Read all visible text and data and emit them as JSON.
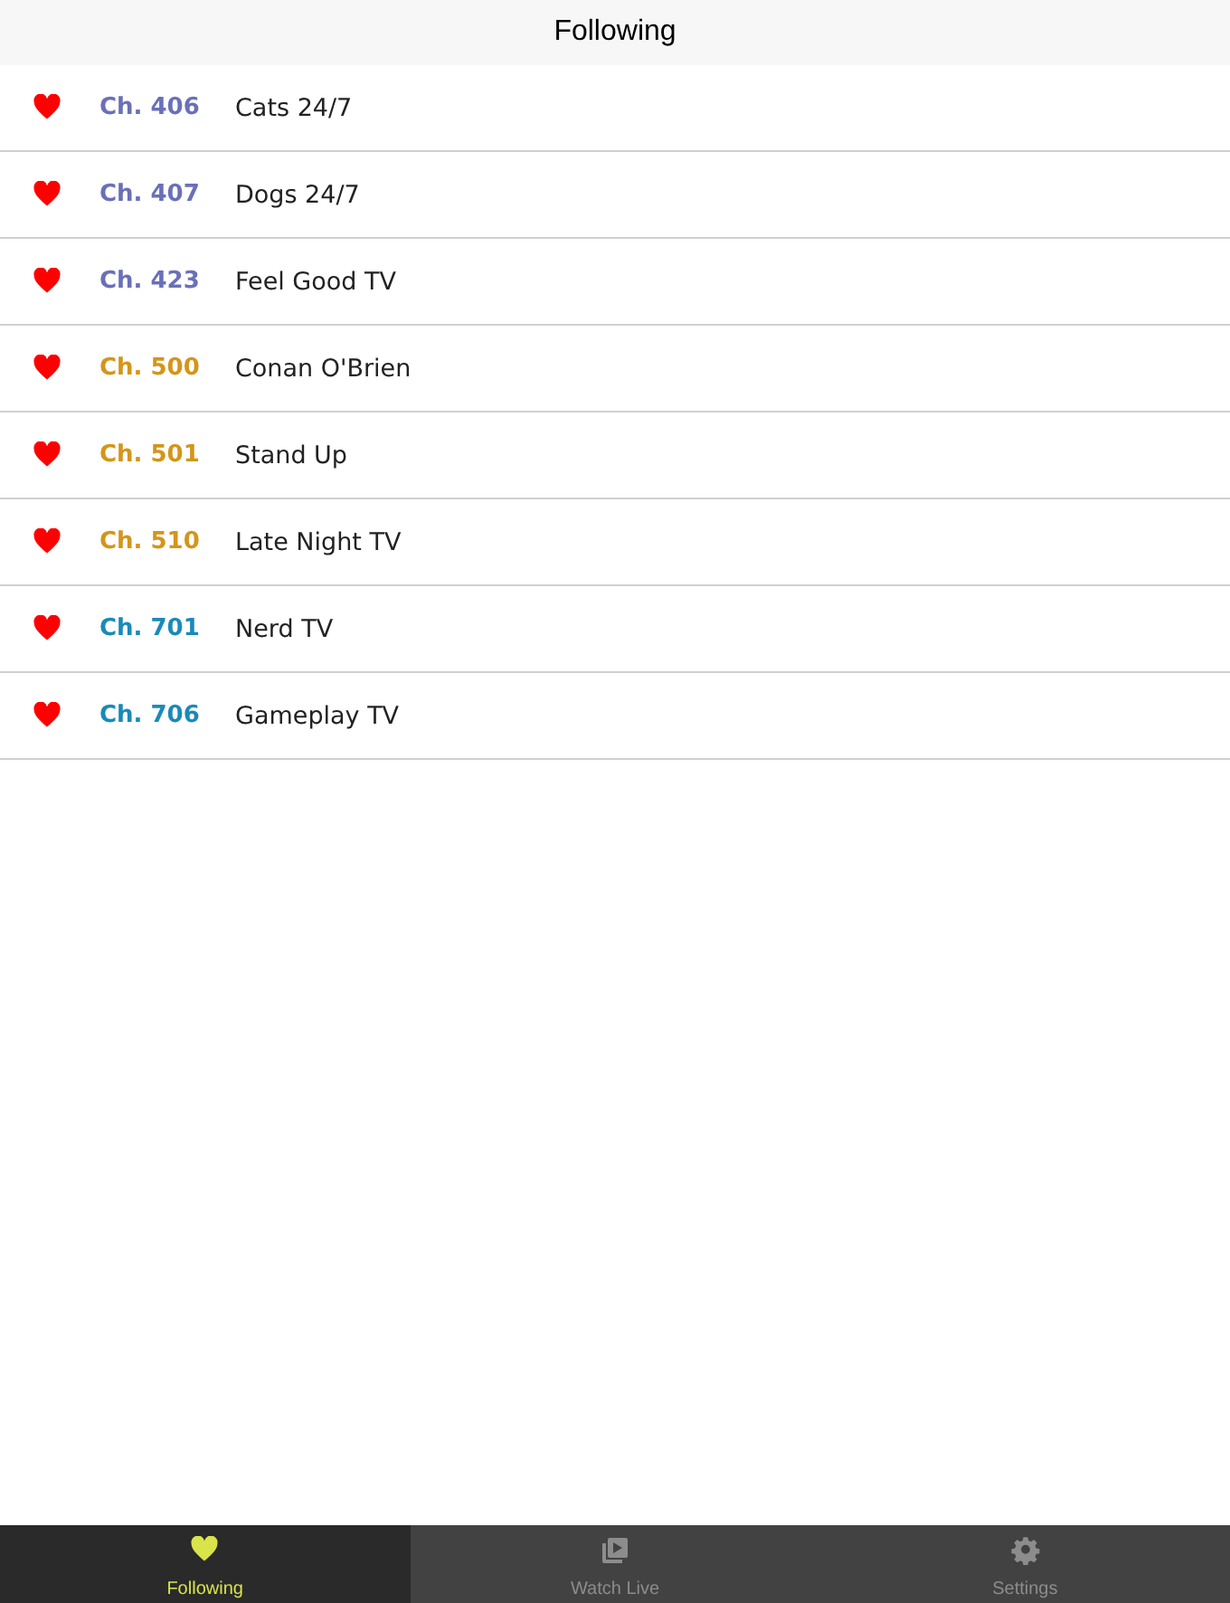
{
  "header": {
    "title": "Following"
  },
  "channels": [
    {
      "number": "Ch. 406",
      "name": "Cats 24/7",
      "color": "#6a70b8",
      "favorite": true
    },
    {
      "number": "Ch. 407",
      "name": "Dogs 24/7",
      "color": "#6a70b8",
      "favorite": true
    },
    {
      "number": "Ch. 423",
      "name": "Feel Good TV",
      "color": "#6a70b8",
      "favorite": true
    },
    {
      "number": "Ch. 500",
      "name": "Conan O'Brien",
      "color": "#d4951a",
      "favorite": true
    },
    {
      "number": "Ch. 501",
      "name": "Stand Up",
      "color": "#d4951a",
      "favorite": true
    },
    {
      "number": "Ch. 510",
      "name": "Late Night TV",
      "color": "#d4951a",
      "favorite": true
    },
    {
      "number": "Ch. 701",
      "name": "Nerd TV",
      "color": "#1a8ab8",
      "favorite": true
    },
    {
      "number": "Ch. 706",
      "name": "Gameplay TV",
      "color": "#1a8ab8",
      "favorite": true
    }
  ],
  "tabs": [
    {
      "kind": "heart",
      "label": "Following",
      "selected": true
    },
    {
      "kind": "video",
      "label": "Watch Live",
      "selected": false
    },
    {
      "kind": "gear",
      "label": "Settings",
      "selected": false
    }
  ]
}
